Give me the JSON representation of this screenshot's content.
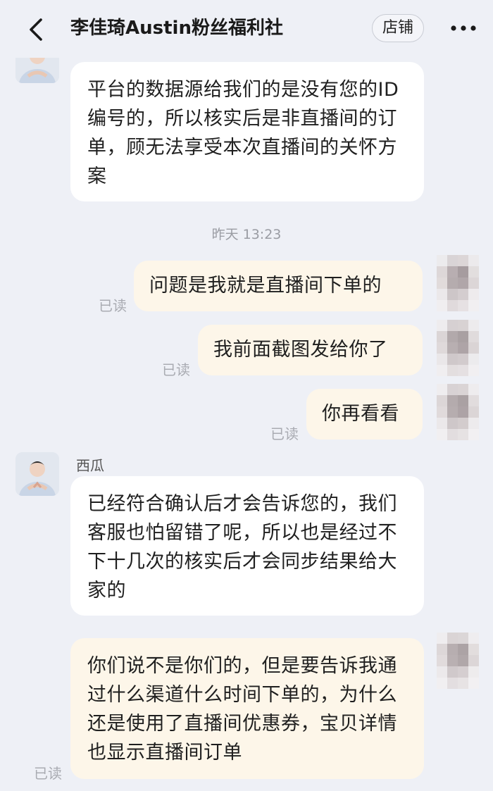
{
  "header": {
    "title": "李佳琦Austin粉丝福利社",
    "store_label": "店铺"
  },
  "messages": [
    {
      "text": "平台的数据源给我们的是没有您的ID编号的，所以核实后是非直播间的订单，顾无法享受本次直播间的关怀方案"
    },
    {
      "timestamp": "昨天 13:23"
    },
    {
      "text": "问题是我就是直播间下单的",
      "read": "已读"
    },
    {
      "text": "我前面截图发给你了",
      "read": "已读"
    },
    {
      "text": "你再看看",
      "read": "已读"
    },
    {
      "sender": "西瓜",
      "text": "已经符合确认后才会告诉您的，我们客服也怕留错了呢，所以也是经过不下十几次的核实后才会同步结果给大家的"
    },
    {
      "text": "你们说不是你们的，但是要告诉我通过什么渠道什么时间下单的，为什么还是使用了直播间优惠券，宝贝详情也显示直播间订单",
      "read": "已读"
    }
  ],
  "icons": [
    "back-arrow-icon",
    "more-dots-icon",
    "avatar-image",
    "avatar-image-blurred"
  ],
  "colors": {
    "background": "#eef0f6",
    "incoming_bubble": "#ffffff",
    "outgoing_bubble": "#fdf6e9",
    "read_text": "#a9abb2"
  }
}
